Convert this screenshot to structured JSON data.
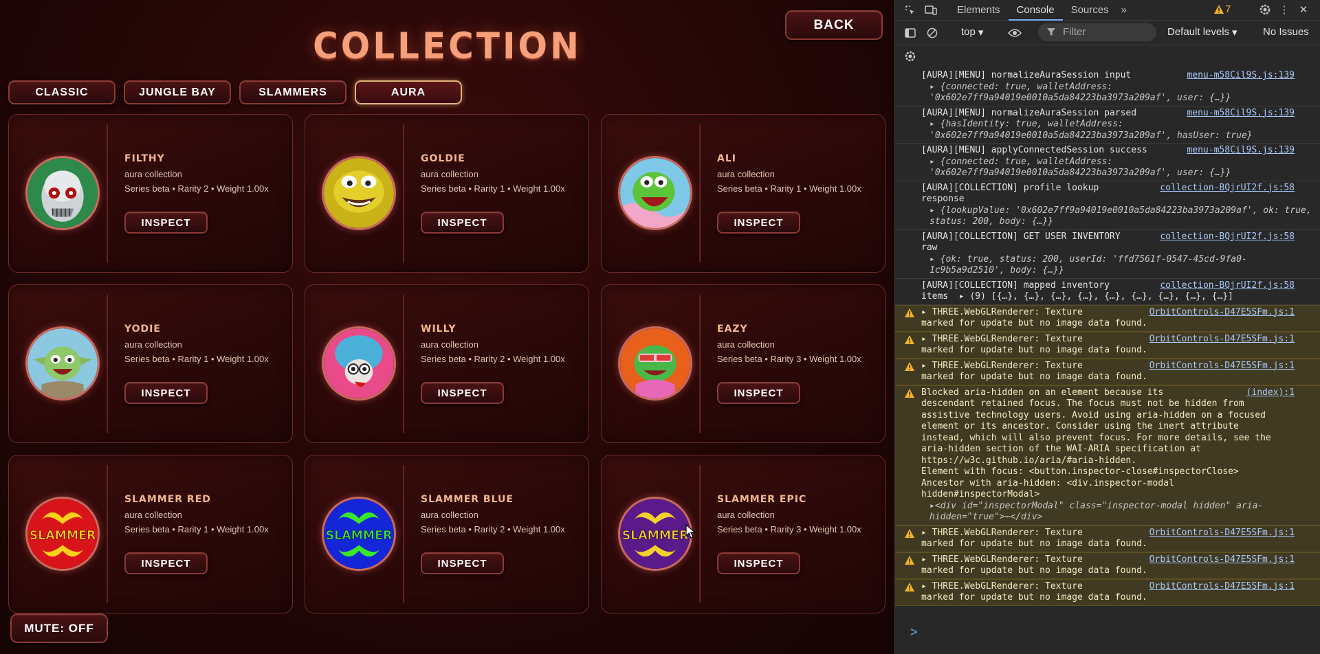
{
  "game": {
    "title": "COLLECTION",
    "back_label": "BACK",
    "mute_label": "MUTE: OFF",
    "tabs": [
      {
        "label": "CLASSIC",
        "active": false
      },
      {
        "label": "JUNGLE BAY",
        "active": false
      },
      {
        "label": "SLAMMERS",
        "active": false
      },
      {
        "label": "AURA",
        "active": true
      }
    ],
    "cards": [
      {
        "name": "FILTHY",
        "collection": "aura collection",
        "meta": "Series beta • Rarity 2 • Weight 1.00x",
        "button": "INSPECT",
        "avatar": "alien-skull-avatar"
      },
      {
        "name": "GOLDIE",
        "collection": "aura collection",
        "meta": "Series beta • Rarity 1 • Weight 1.00x",
        "button": "INSPECT",
        "avatar": "gold-frog-avatar"
      },
      {
        "name": "ALI",
        "collection": "aura collection",
        "meta": "Series beta • Rarity 1 • Weight 1.00x",
        "button": "INSPECT",
        "avatar": "green-frog-avatar"
      },
      {
        "name": "YODIE",
        "collection": "aura collection",
        "meta": "Series beta • Rarity 1 • Weight 1.00x",
        "button": "INSPECT",
        "avatar": "yoda-frog-avatar"
      },
      {
        "name": "WILLY",
        "collection": "aura collection",
        "meta": "Series beta • Rarity 2 • Weight 1.00x",
        "button": "INSPECT",
        "avatar": "blue-creature-avatar"
      },
      {
        "name": "EAZY",
        "collection": "aura collection",
        "meta": "Series beta • Rarity 3 • Weight 1.00x",
        "button": "INSPECT",
        "avatar": "pink-frog-avatar"
      },
      {
        "name": "SLAMMER RED",
        "collection": "aura collection",
        "meta": "Series beta • Rarity 1 • Weight 1.00x",
        "button": "INSPECT",
        "avatar": "slammer-red-avatar"
      },
      {
        "name": "SLAMMER BLUE",
        "collection": "aura collection",
        "meta": "Series beta • Rarity 2 • Weight 1.00x",
        "button": "INSPECT",
        "avatar": "slammer-blue-avatar"
      },
      {
        "name": "SLAMMER EPIC",
        "collection": "aura collection",
        "meta": "Series beta • Rarity 3 • Weight 1.00x",
        "button": "INSPECT",
        "avatar": "slammer-epic-avatar"
      }
    ],
    "slammer_text": "SLAMMER",
    "colors": {
      "title": "#f5a07a",
      "accent": "#8a3a36",
      "card_bg": "#2a0808"
    }
  },
  "devtools": {
    "tabs": [
      "Elements",
      "Console",
      "Sources"
    ],
    "active_tab": "Console",
    "warning_count": "7",
    "context": "top",
    "filter_placeholder": "Filter",
    "levels": "Default levels",
    "issues": "No Issues",
    "messages": [
      {
        "type": "log",
        "text": "[AURA][MENU] normalizeAuraSession input",
        "src": "menu-m58Cil9S.js:139",
        "obj": "▸ {connected: true, walletAddress: '0x602e7ff9a94019e0010a5da84223ba3973a209af', user: {…}}"
      },
      {
        "type": "log",
        "text": "[AURA][MENU] normalizeAuraSession parsed",
        "src": "menu-m58Cil9S.js:139",
        "obj": "▸ {hasIdentity: true, walletAddress: '0x602e7ff9a94019e0010a5da84223ba3973a209af', hasUser: true}"
      },
      {
        "type": "log",
        "text": "[AURA][MENU] applyConnectedSession success",
        "src": "menu-m58Cil9S.js:139",
        "obj": "▸ {connected: true, walletAddress: '0x602e7ff9a94019e0010a5da84223ba3973a209af', user: {…}}"
      },
      {
        "type": "log",
        "text": "[AURA][COLLECTION] profile lookup\nresponse",
        "src": "collection-BQjrUI2f.js:58",
        "obj": "▸ {lookupValue: '0x602e7ff9a94019e0010a5da84223ba3973a209af', ok: true, status: 200, body: {…}}"
      },
      {
        "type": "log",
        "text": "[AURA][COLLECTION] GET USER INVENTORY\nraw",
        "src": "collection-BQjrUI2f.js:58",
        "obj": "▸ {ok: true, status: 200, userId: 'ffd7561f-0547-45cd-9fa0-1c9b5a9d2510', body: {…}}"
      },
      {
        "type": "log",
        "text": "[AURA][COLLECTION] mapped inventory\nitems  ▸ (9) [{…}, {…}, {…}, {…}, {…}, {…}, {…}, {…}, {…}]",
        "src": "collection-BQjrUI2f.js:58",
        "obj": ""
      },
      {
        "type": "warn",
        "text": "▸ THREE.WebGLRenderer: Texture\nmarked for update but no image data found.",
        "src": "OrbitControls-D47E5SFm.js:1",
        "obj": ""
      },
      {
        "type": "warn",
        "text": "▸ THREE.WebGLRenderer: Texture\nmarked for update but no image data found.",
        "src": "OrbitControls-D47E5SFm.js:1",
        "obj": ""
      },
      {
        "type": "warn",
        "text": "▸ THREE.WebGLRenderer: Texture\nmarked for update but no image data found.",
        "src": "OrbitControls-D47E5SFm.js:1",
        "obj": ""
      },
      {
        "type": "warn",
        "text": "Blocked aria-hidden on an element because its\ndescendant retained focus. The focus must not be hidden from\nassistive technology users. Avoid using aria-hidden on a focused\nelement or its ancestor. Consider using the inert attribute\ninstead, which will also prevent focus. For more details, see the\naria-hidden section of the WAI-ARIA specification at\nhttps://w3c.github.io/aria/#aria-hidden.\nElement with focus: <button.inspector-close#inspectorClose>\nAncestor with aria-hidden: <div.inspector-modal\nhidden#inspectorModal>",
        "src": "(index):1",
        "obj": "▸<div id=\"inspectorModal\" class=\"inspector-modal hidden\" aria-hidden=\"true\">⋯</div>"
      },
      {
        "type": "warn",
        "text": "▸ THREE.WebGLRenderer: Texture\nmarked for update but no image data found.",
        "src": "OrbitControls-D47E5SFm.js:1",
        "obj": ""
      },
      {
        "type": "warn",
        "text": "▸ THREE.WebGLRenderer: Texture\nmarked for update but no image data found.",
        "src": "OrbitControls-D47E5SFm.js:1",
        "obj": ""
      },
      {
        "type": "warn",
        "text": "▸ THREE.WebGLRenderer: Texture\nmarked for update but no image data found.",
        "src": "OrbitControls-D47E5SFm.js:1",
        "obj": ""
      }
    ],
    "prompt": ">"
  }
}
